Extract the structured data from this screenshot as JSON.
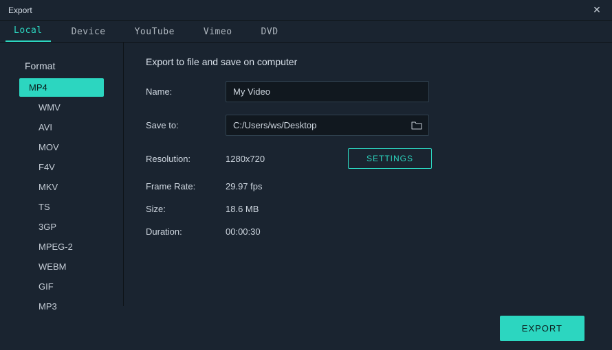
{
  "window": {
    "title": "Export"
  },
  "tabs": {
    "local": "Local",
    "device": "Device",
    "youtube": "YouTube",
    "vimeo": "Vimeo",
    "dvd": "DVD",
    "active": "local"
  },
  "sidebar": {
    "header": "Format",
    "items": [
      {
        "label": "MP4",
        "selected": true
      },
      {
        "label": "WMV",
        "selected": false
      },
      {
        "label": "AVI",
        "selected": false
      },
      {
        "label": "MOV",
        "selected": false
      },
      {
        "label": "F4V",
        "selected": false
      },
      {
        "label": "MKV",
        "selected": false
      },
      {
        "label": "TS",
        "selected": false
      },
      {
        "label": "3GP",
        "selected": false
      },
      {
        "label": "MPEG-2",
        "selected": false
      },
      {
        "label": "WEBM",
        "selected": false
      },
      {
        "label": "GIF",
        "selected": false
      },
      {
        "label": "MP3",
        "selected": false
      }
    ]
  },
  "content": {
    "title": "Export to file and save on computer",
    "nameLabel": "Name:",
    "nameValue": "My Video",
    "saveToLabel": "Save to:",
    "saveToValue": "C:/Users/ws/Desktop",
    "resolutionLabel": "Resolution:",
    "resolutionValue": "1280x720",
    "settingsButton": "SETTINGS",
    "frameRateLabel": "Frame Rate:",
    "frameRateValue": "29.97 fps",
    "sizeLabel": "Size:",
    "sizeValue": "18.6 MB",
    "durationLabel": "Duration:",
    "durationValue": "00:00:30"
  },
  "footer": {
    "exportButton": "EXPORT"
  }
}
